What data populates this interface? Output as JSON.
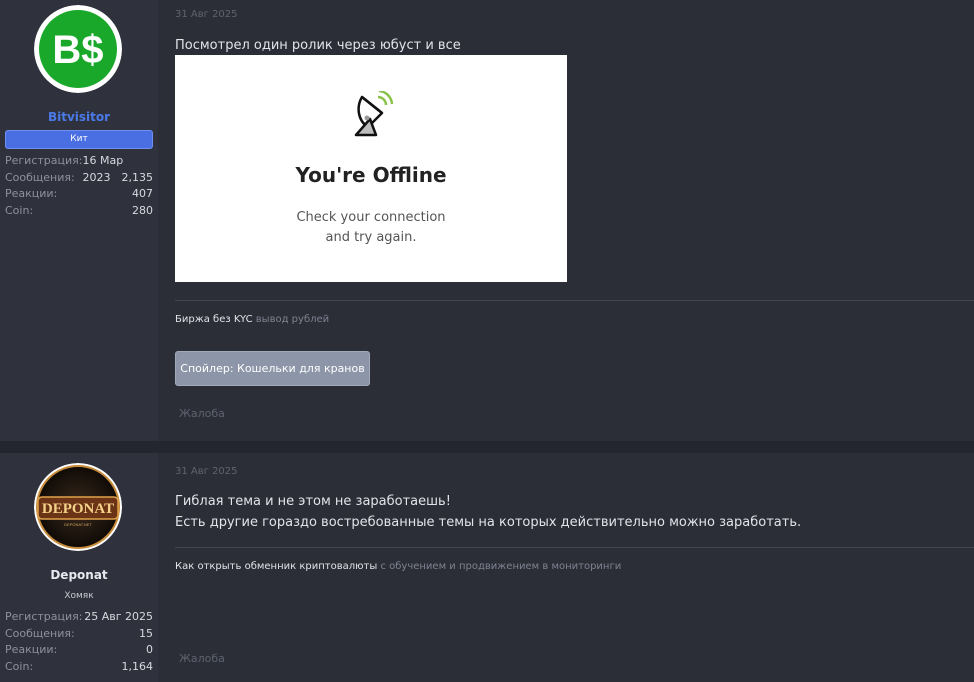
{
  "posts": [
    {
      "avatar_text": "B$",
      "username": "Bitvisitor",
      "rank": "Кит",
      "stats": [
        {
          "label": "Регистрация:",
          "value": "16 Мар 2023"
        },
        {
          "label": "Сообщения:",
          "value": "2,135"
        },
        {
          "label": "Реакции:",
          "value": "407"
        },
        {
          "label": "Coin:",
          "value": "280"
        }
      ],
      "date": "31 Авг 2025",
      "message_lines": [
        "Посмотрел один ролик через юбуст и все"
      ],
      "embed": {
        "title": "You're Offline",
        "subtitle_line1": "Check your connection",
        "subtitle_line2": "and try again."
      },
      "signature": {
        "text": "Биржа без KYC",
        "link": "вывод рублей"
      },
      "spoiler_label": "Спойлер: Кошельки для кранов",
      "report_label": "Жалоба"
    },
    {
      "avatar_text": "DEPONAT",
      "avatar_subtext": "DEPONAT.NET",
      "username": "Deponat",
      "rank": "Хомяк",
      "stats": [
        {
          "label": "Регистрация:",
          "value": "25 Авг 2025"
        },
        {
          "label": "Сообщения:",
          "value": "15"
        },
        {
          "label": "Реакции:",
          "value": "0"
        },
        {
          "label": "Coin:",
          "value": "1,164"
        }
      ],
      "date": "31 Авг 2025",
      "message_lines": [
        "Гиблая тема и не этом не заработаешь!",
        "Есть другие гораздо востребованные темы на которых действительно можно заработать."
      ],
      "signature": {
        "text": "Как открыть обменник криптовалюты",
        "link": "с обучением и продвижением в мониторинги"
      },
      "report_label": "Жалоба"
    }
  ],
  "colors": {
    "background": "#2b2d37",
    "username_link": "#4a7ae8",
    "rank_badge": "#4a6fe3",
    "spoiler_button": "#8d96a8",
    "bitvisitor_green": "#1aa82b"
  }
}
